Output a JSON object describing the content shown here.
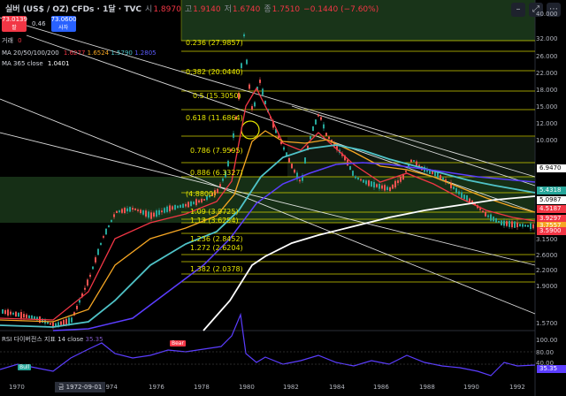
{
  "header": {
    "symbol": "실버 (US$ / OZ) CFDs · 1달 · TVC",
    "ohlc": [
      {
        "label": "시",
        "value": "1.8970"
      },
      {
        "label": "고",
        "value": "1.9140"
      },
      {
        "label": "저",
        "value": "1.6740"
      },
      {
        "label": "종",
        "value": "1.7510"
      },
      {
        "label": "",
        "value": "−0.1440 (−7.60%)"
      }
    ],
    "sell_price": "73.0139",
    "sell_label": "팔",
    "buy_price": "73.0600",
    "buy_label": "사자",
    "spread": "0.46"
  },
  "indicators": [
    {
      "label": "거래",
      "values": [
        {
          "text": "0",
          "color": "red"
        }
      ]
    },
    {
      "label": "MA 20/50/100/200",
      "values": [
        {
          "text": "1.6277",
          "color": "red"
        },
        {
          "text": "1.6524",
          "color": "orange"
        },
        {
          "text": "1.5790",
          "color": "teal"
        },
        {
          "text": "1.2805",
          "color": "blue"
        }
      ]
    },
    {
      "label": "MA 365 close",
      "values": [
        {
          "text": "1.0401",
          "color": "white"
        }
      ]
    }
  ],
  "rsi": {
    "label": "RSI 다이버전스 지표",
    "length": "14 close",
    "value": "35.35",
    "tags": [
      "Bear",
      "Bull"
    ]
  },
  "colors": {
    "up": "#26a69a",
    "down": "#ef5350",
    "fib": "#e6e600",
    "ma20": "#f23645",
    "ma50": "#f5a623",
    "ma100": "#4fc3c8",
    "ma200": "#5b3dff",
    "ma365": "#ffffff",
    "rsi": "#5b3dff",
    "zone": "#1e3a1e"
  },
  "chart_data": {
    "type": "candlestick",
    "x_ticks": [
      "1970",
      "1974",
      "1976",
      "1978",
      "1980",
      "1982",
      "1984",
      "1986",
      "1988",
      "1990",
      "1992"
    ],
    "cursor_date": "금 1972-09-01",
    "price_ticks": [
      "40.000",
      "32.000",
      "26.000",
      "22.000",
      "18.000",
      "15.000",
      "12.000",
      "10.000",
      "6.9470",
      "5.4318",
      "5.0987",
      "3.1500",
      "2.6000",
      "2.2000",
      "1.9000",
      "1.5700"
    ],
    "price_tags": [
      {
        "text": "6.9470",
        "color": "#000000",
        "bg": "#ffffff"
      },
      {
        "text": "5.4318",
        "color": "#ffffff",
        "bg": "#26a69a"
      },
      {
        "text": "5.0987",
        "color": "#000000",
        "bg": "#ffffff"
      },
      {
        "text": "4.5187",
        "color": "#ffffff",
        "bg": "#f23645"
      },
      {
        "text": "3.9297",
        "color": "#ffffff",
        "bg": "#f23645"
      },
      {
        "text": "3.7557",
        "color": "#ffffff",
        "bg": "#f5a623"
      },
      {
        "text": "3.5900",
        "color": "#ffffff",
        "bg": "#f23645"
      }
    ],
    "fib_levels": [
      {
        "label": "0.236 (27.9857)"
      },
      {
        "label": "0.382 (20.0440)"
      },
      {
        "label": "0.5 (15.3050)"
      },
      {
        "label": "0.618 (11.6864)"
      },
      {
        "label": "0.786 (7.9595)"
      },
      {
        "label": "0.886 (6.3327)"
      },
      {
        "label": "(4.8800)"
      },
      {
        "label": "1.09 (3.9725)"
      },
      {
        "label": "1.13 (3.6254)"
      },
      {
        "label": "1.236 (2.8452)"
      },
      {
        "label": "1.272 (2.6204)"
      },
      {
        "label": "1.382 (2.0378)"
      }
    ],
    "rsi_ticks": [
      "100.00",
      "80.00",
      "60.00",
      "40.00",
      "35.35"
    ]
  }
}
